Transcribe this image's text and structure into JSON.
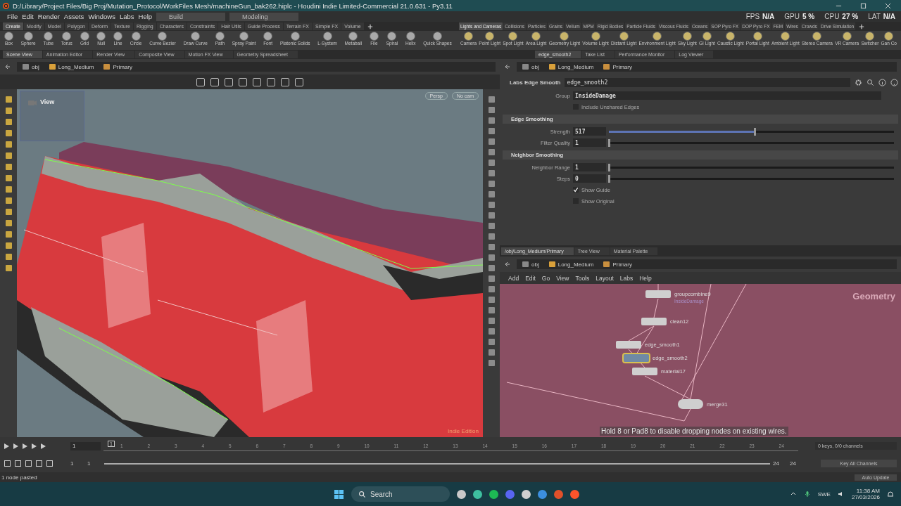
{
  "window": {
    "title": "D:/Library/Project Files/Big Proj/Mutation_Protocol/WorkFiles Mesh/machineGun_bak262.hiplc - Houdini Indie Limited-Commercial 21.0.631 - Py3.11"
  },
  "menu": [
    "File",
    "Edit",
    "Render",
    "Assets",
    "Windows",
    "Labs",
    "Help"
  ],
  "desktops": [
    {
      "label": "Build"
    },
    {
      "label": "Modeling"
    }
  ],
  "perf": [
    {
      "label": "FPS",
      "value": "N/A"
    },
    {
      "label": "GPU",
      "value": "5 %"
    },
    {
      "label": "CPU",
      "value": "27 %"
    },
    {
      "label": "LAT",
      "value": "N/A"
    }
  ],
  "shelves": [
    {
      "tabs": [
        {
          "label": "Create",
          "selected": true
        },
        {
          "label": "Modify",
          "selected": false
        },
        {
          "label": "Model",
          "selected": false
        },
        {
          "label": "Polygon",
          "selected": false
        },
        {
          "label": "Deform",
          "selected": false
        },
        {
          "label": "Texture",
          "selected": false
        },
        {
          "label": "Rigging",
          "selected": false
        },
        {
          "label": "Characters",
          "selected": false
        },
        {
          "label": "Constraints",
          "selected": false
        },
        {
          "label": "Hair Utils",
          "selected": false
        },
        {
          "label": "Guide Process",
          "selected": false
        },
        {
          "label": "Terrain FX",
          "selected": false
        },
        {
          "label": "Simple FX",
          "selected": false
        },
        {
          "label": "Volume",
          "selected": false
        }
      ],
      "tools": [
        "Box",
        "Sphere",
        "Tube",
        "Torus",
        "Grid",
        "Null",
        "Line",
        "Circle",
        "Curve Bezier",
        "Draw Curve",
        "Path",
        "Spray Paint",
        "Font",
        "Platonic Solids",
        "L-System",
        "Metaball",
        "File",
        "Spiral",
        "Helix",
        "Quick Shapes"
      ]
    },
    {
      "tabs": [
        {
          "label": "Lights and Cameras",
          "selected": true
        },
        {
          "label": "Collisions",
          "selected": false
        },
        {
          "label": "Particles",
          "selected": false
        },
        {
          "label": "Grains",
          "selected": false
        },
        {
          "label": "Vellum",
          "selected": false
        },
        {
          "label": "MPM",
          "selected": false
        },
        {
          "label": "Rigid Bodies",
          "selected": false
        },
        {
          "label": "Particle Fluids",
          "selected": false
        },
        {
          "label": "Viscous Fluids",
          "selected": false
        },
        {
          "label": "Oceans",
          "selected": false
        },
        {
          "label": "SOP Pyro FX",
          "selected": false
        },
        {
          "label": "DOP Pyro FX",
          "selected": false
        },
        {
          "label": "FEM",
          "selected": false
        },
        {
          "label": "Wires",
          "selected": false
        },
        {
          "label": "Crowds",
          "selected": false
        },
        {
          "label": "Drive Simulation",
          "selected": false
        }
      ],
      "tools": [
        "Camera",
        "Point Light",
        "Spot Light",
        "Area Light",
        "Geometry Light",
        "Volume Light",
        "Distant Light",
        "Environment Light",
        "Sky Light",
        "GI Light",
        "Caustic Light",
        "Portal Light",
        "Ambient Light",
        "Stereo Camera",
        "VR Camera",
        "Switcher",
        "Gan Co"
      ]
    }
  ],
  "left_pane": {
    "tabs": [
      {
        "label": "Scene View",
        "selected": true
      },
      {
        "label": "Animation Editor",
        "selected": false
      },
      {
        "label": "Render View",
        "selected": false
      },
      {
        "label": "Composite View",
        "selected": false
      },
      {
        "label": "Motion FX View",
        "selected": false
      },
      {
        "label": "Geometry Spreadsheet",
        "selected": false
      }
    ],
    "path": [
      "obj",
      "Long_Medium",
      "Primary"
    ],
    "viewport": {
      "overlay_title": "View",
      "projection": "Persp",
      "camera": "No cam",
      "edition": "Indie Edition"
    }
  },
  "right_pane": {
    "tabs": [
      {
        "label": "edge_smooth2",
        "selected": true
      },
      {
        "label": "Take List",
        "selected": false
      },
      {
        "label": "Performance Monitor",
        "selected": false
      },
      {
        "label": "Log Viewer",
        "selected": false
      }
    ],
    "path": [
      "obj",
      "Long_Medium",
      "Primary"
    ],
    "parameters": {
      "node_type": "Labs Edge Smooth",
      "node_name": "edge_smooth2",
      "rows": [
        {
          "kind": "string",
          "label": "Group",
          "value": "InsideDamage"
        },
        {
          "kind": "checkbox",
          "label": "Include Unshared Edges",
          "checked": false
        },
        {
          "kind": "section",
          "label": "Edge Smoothing"
        },
        {
          "kind": "slider",
          "label": "Strength",
          "value": "517",
          "level": 0.51
        },
        {
          "kind": "slider",
          "label": "Filter Quality",
          "value": "1",
          "level": 0
        },
        {
          "kind": "section",
          "label": "Neighbor Smoothing"
        },
        {
          "kind": "slider",
          "label": "Neighbor Range",
          "value": "1",
          "level": 0
        },
        {
          "kind": "slider",
          "label": "Steps",
          "value": "0",
          "level": 0
        },
        {
          "kind": "checkbox",
          "label": "Show Guide",
          "checked": true
        },
        {
          "kind": "checkbox",
          "label": "Show Original",
          "checked": false
        }
      ]
    }
  },
  "network_pane": {
    "tabs": [
      {
        "label": "/obj/Long_Medium/Primary",
        "selected": true
      },
      {
        "label": "Tree View",
        "selected": false
      },
      {
        "label": "Material Palette",
        "selected": false
      }
    ],
    "path": [
      "obj",
      "Long_Medium",
      "Primary"
    ],
    "menu": [
      "Add",
      "Edit",
      "Go",
      "View",
      "Tools",
      "Layout",
      "Labs",
      "Help"
    ],
    "context": "Geometry",
    "nodes": [
      {
        "name": "groupcombine9",
        "note": "InsideDamage",
        "selected": false
      },
      {
        "name": "clean12",
        "selected": false
      },
      {
        "name": "edge_smooth1",
        "selected": false
      },
      {
        "name": "edge_smooth2",
        "selected": true
      },
      {
        "name": "material17",
        "selected": false
      },
      {
        "name": "merge31",
        "selected": false
      }
    ],
    "hint": "Hold 8 or Pad8 to disable dropping nodes on existing wires."
  },
  "timeline": {
    "current_frame": "1",
    "marker": "1",
    "frames": [
      "1",
      "2",
      "3",
      "4",
      "5",
      "6",
      "7",
      "8",
      "9",
      "10",
      "11",
      "12",
      "13",
      "14",
      "15",
      "16",
      "17",
      "18",
      "19",
      "20",
      "21",
      "22",
      "23",
      "24"
    ],
    "range_start": "1",
    "range_start_2": "1",
    "range_end": "24",
    "range_end_2": "24",
    "keys": "0 keys, 0/0 channels",
    "key_button": "Key All Channels",
    "update": "Auto Update"
  },
  "status": "1 node pasted",
  "taskbar": {
    "search": "Search",
    "language": "SWE",
    "time": "11:38 AM",
    "date": "27/03/2026"
  }
}
